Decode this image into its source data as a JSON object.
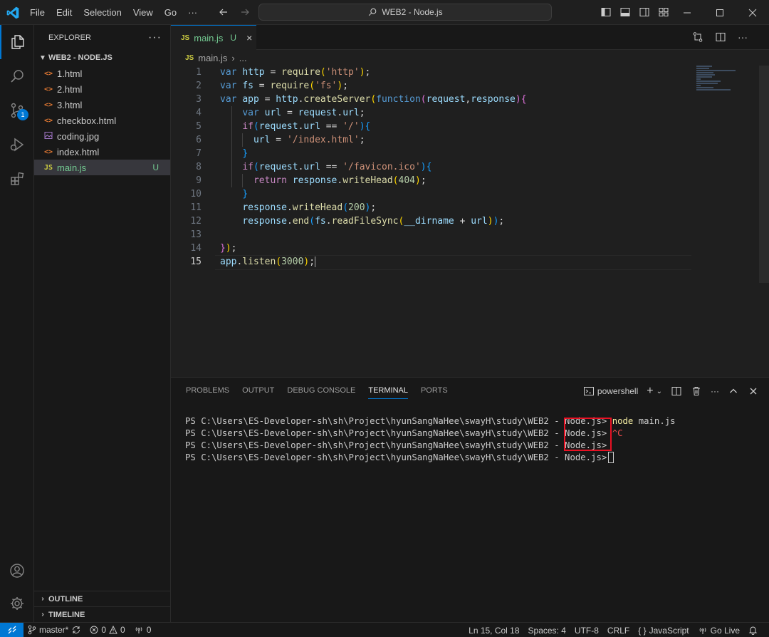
{
  "titlebar": {
    "menu": [
      "File",
      "Edit",
      "Selection",
      "View",
      "Go",
      "···"
    ],
    "command_center": "WEB2 - Node.js"
  },
  "activity_bar": {
    "source_control_badge": "1"
  },
  "explorer": {
    "header": "EXPLORER",
    "more": "···",
    "folder": "WEB2 - NODE.JS",
    "files": [
      {
        "icon": "<>",
        "name": "1.html",
        "status": ""
      },
      {
        "icon": "<>",
        "name": "2.html",
        "status": ""
      },
      {
        "icon": "<>",
        "name": "3.html",
        "status": ""
      },
      {
        "icon": "<>",
        "name": "checkbox.html",
        "status": ""
      },
      {
        "icon": "img",
        "name": "coding.jpg",
        "status": ""
      },
      {
        "icon": "<>",
        "name": "index.html",
        "status": ""
      },
      {
        "icon": "JS",
        "name": "main.js",
        "status": "U"
      }
    ],
    "outline": "OUTLINE",
    "timeline": "TIMELINE"
  },
  "editor": {
    "tab": {
      "icon": "JS",
      "name": "main.js",
      "status": "U",
      "close": "×"
    },
    "breadcrumb": {
      "icon": "JS",
      "file": "main.js",
      "more": "..."
    },
    "line_numbers": [
      "1",
      "2",
      "3",
      "4",
      "5",
      "6",
      "7",
      "8",
      "9",
      "10",
      "11",
      "12",
      "13",
      "14",
      "15"
    ],
    "current_line": 15,
    "code_lines": [
      "var http = require('http');",
      "var fs = require('fs');",
      "var app = http.createServer(function(request,response){",
      "    var url = request.url;",
      "    if(request.url == '/'){",
      "      url = '/index.html';",
      "    }",
      "    if(request.url == '/favicon.ico'){",
      "      return response.writeHead(404);",
      "    }",
      "    response.writeHead(200);",
      "    response.end(fs.readFileSync(__dirname + url));",
      "",
      "});",
      "app.listen(3000);"
    ]
  },
  "panel": {
    "tabs": [
      "PROBLEMS",
      "OUTPUT",
      "DEBUG CONSOLE",
      "TERMINAL",
      "PORTS"
    ],
    "active_tab": "TERMINAL",
    "shell": "powershell",
    "terminal": {
      "prompt": "PS C:\\Users\\ES-Developer-sh\\sh\\Project\\hyunSangNaHee\\swayH\\study\\WEB2 - Node.js>",
      "lines": [
        {
          "cmd": "node",
          "args": " main.js"
        },
        {
          "cmd": "^C",
          "args": ""
        },
        {
          "cmd": "",
          "args": ""
        },
        {
          "cmd": "",
          "args": ""
        }
      ]
    }
  },
  "statusbar": {
    "branch": "master*",
    "errors": "0",
    "warnings": "0",
    "ports": "0",
    "position": "Ln 15, Col 18",
    "spaces": "Spaces: 4",
    "encoding": "UTF-8",
    "eol": "CRLF",
    "language": "JavaScript",
    "live": "Go Live"
  }
}
